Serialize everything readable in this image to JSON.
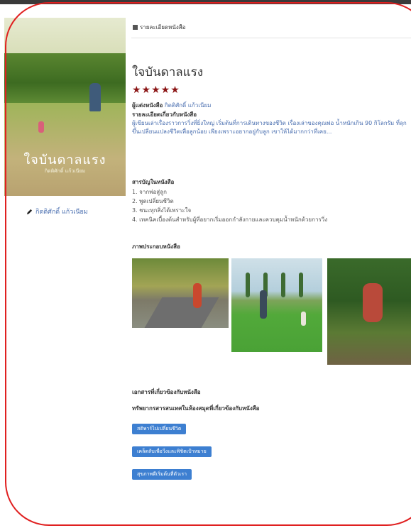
{
  "breadcrumb": {
    "icon": "list-icon",
    "label": "รายละเอียดหนังสือ"
  },
  "book": {
    "cover_title": "ใจบันดาลแรง",
    "cover_author": "กิตติศักดิ์ แก้วเนียม",
    "title": "ใจบันดาลแรง",
    "stars": "★★★★★",
    "rating": 5,
    "meta_label": "ผู้แต่งหนังสือ",
    "author": "กิตติศักดิ์ แก้วเนียม",
    "side_author": "กิตติศักดิ์ แก้วเนียม"
  },
  "details": {
    "heading": "รายละเอียดเกี่ยวกับหนังสือ",
    "description": "ผู้เขียนเล่าเรื่องราวการวิ่งที่ยิ่งใหญ่ เริ่มต้นที่การเดินทางของชีวิต เรื่องเล่าของคุณพ่อ น้ำหนักเกิน 90 กิโลกรัม ที่ลุกขึ้นเปลี่ยนแปลงชีวิตเพื่อลูกน้อย เพียงเพราะอยากอยู่กับลูก เขาให้ได้มากกว่าที่เคย..."
  },
  "toc": {
    "heading": "สารบัญในหนังสือ",
    "items": [
      "1. จากพ่อสู่ลูก",
      "2. พูดเปลี่ยนชีวิต",
      "3. ชนะทุกสิ่งได้เพราะใจ",
      "4. เทคนิคเบื้องต้นสำหรับผู้ที่อยากเริ่มออกกำลังกายและควบคุมน้ำหนักด้วยการวิ่ง"
    ]
  },
  "gallery": {
    "heading": "ภาพประกอบหนังสือ"
  },
  "related": {
    "heading": "เอกสารที่เกี่ยวข้องกับหนังสือ",
    "subheading": "ทรัพยากรสารสนเทศในห้องสมุดที่เกี่ยวข้องกับหนังสือ",
    "buttons": [
      "สติพาร์ไปเปลี่ยนชีวิต",
      "เคล็ดลับเพื่อวิ่งและพิชิตเป้าหมาย",
      "สุขภาพดีเริ่มต้นที่ตัวเรา"
    ]
  },
  "colors": {
    "accent": "#3d7fd1",
    "link": "#4a6fb0",
    "star": "#8b1414",
    "frame": "#e02020"
  }
}
